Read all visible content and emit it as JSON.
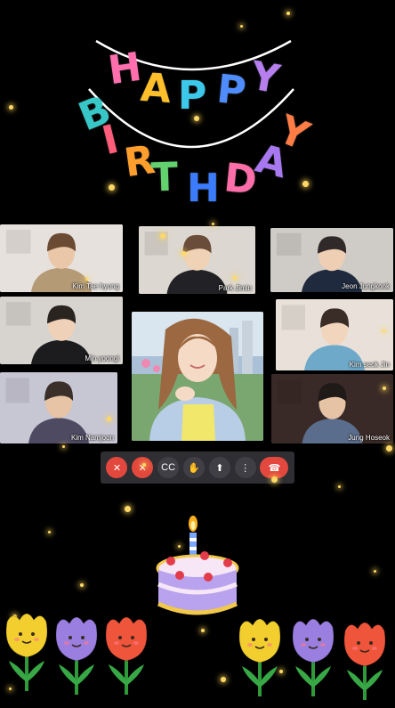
{
  "banner": {
    "letters": [
      {
        "ch": "H",
        "color": "#ff6fae"
      },
      {
        "ch": "A",
        "color": "#ffbf2a"
      },
      {
        "ch": "P",
        "color": "#3cc8ea"
      },
      {
        "ch": "P",
        "color": "#4f8dff"
      },
      {
        "ch": "Y",
        "color": "#b77ef0"
      },
      {
        "ch": "B",
        "color": "#38c7c7"
      },
      {
        "ch": "I",
        "color": "#ff5d7a"
      },
      {
        "ch": "R",
        "color": "#ff9e2c"
      },
      {
        "ch": "T",
        "color": "#62d26f"
      },
      {
        "ch": "H",
        "color": "#3b7cff"
      },
      {
        "ch": "D",
        "color": "#ff6ea8"
      },
      {
        "ch": "A",
        "color": "#a778f0"
      },
      {
        "ch": "Y",
        "color": "#ff7d45"
      }
    ]
  },
  "participants": [
    {
      "name": "Kim Tae hyung",
      "bg": "#e6e1dd",
      "skin": "#e9c7a8",
      "hair": "#6b4a33",
      "shirt": "#b59a76"
    },
    {
      "name": "Park Jimin",
      "bg": "#dcd7d0",
      "skin": "#f0d2b6",
      "hair": "#6a4c3a",
      "shirt": "#222226"
    },
    {
      "name": "Jeon Jungkook",
      "bg": "#cfcbc6",
      "skin": "#efcfb4",
      "hair": "#2f2a29",
      "shirt": "#1f2a3e"
    },
    {
      "name": "Min yoongi",
      "bg": "#d7d3ce",
      "skin": "#eed1b7",
      "hair": "#2a2420",
      "shirt": "#1c1c1e"
    },
    {
      "name": "Kim seok Jin",
      "bg": "#e9e1d9",
      "skin": "#f2d5bd",
      "hair": "#3a2d28",
      "shirt": "#6fa9c9"
    },
    {
      "name": "Kim Namjoon",
      "bg": "#c7c6d3",
      "skin": "#e6c4a5",
      "hair": "#3b2f2a",
      "shirt": "#4e4a62"
    },
    {
      "name": "Jung Hoseok",
      "bg": "#3a2a27",
      "skin": "#e5c3a4",
      "hair": "#1f1a18",
      "shirt": "#5b6d8c"
    }
  ],
  "center_tile": {
    "bg": "#a9c0d6",
    "skin": "#f5dac5",
    "hair": "#9b6841",
    "top": "#f1e86b",
    "shirt": "#b8cde6"
  },
  "controls": [
    {
      "icon": "mic-off-icon",
      "style": "red",
      "glyph": "✕"
    },
    {
      "icon": "camera-off-icon",
      "style": "red",
      "glyph": "✕"
    },
    {
      "icon": "captions-icon",
      "style": "dark",
      "glyph": "CC"
    },
    {
      "icon": "raise-hand-icon",
      "style": "dark",
      "glyph": "✋"
    },
    {
      "icon": "present-screen-icon",
      "style": "dark",
      "glyph": "⬆"
    },
    {
      "icon": "more-options-icon",
      "style": "dark",
      "glyph": "⋮"
    },
    {
      "icon": "end-call-icon",
      "style": "end",
      "glyph": "☎"
    }
  ],
  "colors": {
    "background": "#000000",
    "sparkle": "#ffd866",
    "control_bar": "#2e2e33",
    "danger": "#e2483d"
  },
  "cake": {
    "icon": "birthday-cake-icon"
  },
  "flowers": [
    {
      "icon": "yellow-tulip-icon",
      "color": "#f2cf2e"
    },
    {
      "icon": "purple-tulip-icon",
      "color": "#9a7ee0"
    },
    {
      "icon": "red-tulip-icon",
      "color": "#ef553a"
    },
    {
      "icon": "yellow-tulip-icon",
      "color": "#f2cf2e"
    },
    {
      "icon": "purple-tulip-icon",
      "color": "#9a7ee0"
    },
    {
      "icon": "red-tulip-icon",
      "color": "#ef553a"
    }
  ]
}
